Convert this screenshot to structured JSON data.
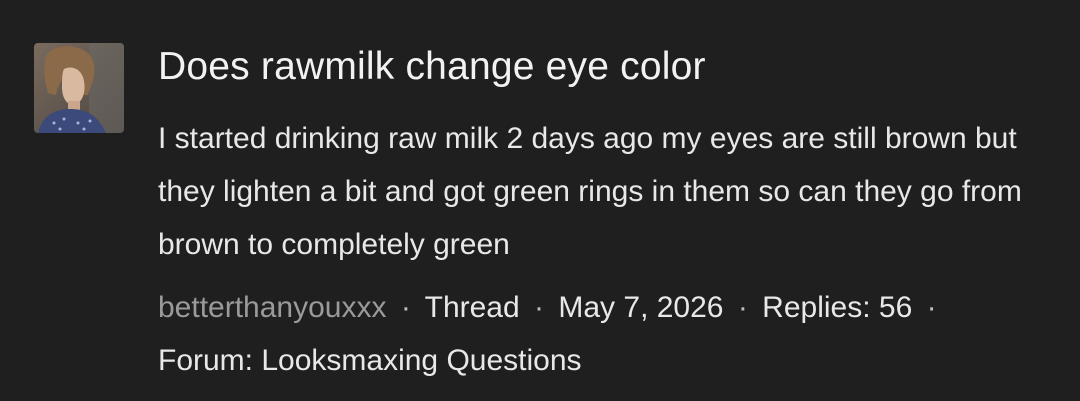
{
  "result": {
    "avatar_icon": "user-avatar-photo",
    "title": "Does rawmilk change eye color",
    "snippet": "I started drinking raw milk 2 days ago my eyes are still brown but they lighten a bit and got green rings in them so can they go from brown to completely green",
    "meta": {
      "author": "betterthanyouxxx",
      "separator": "·",
      "type": "Thread",
      "date": "May 7, 2026",
      "replies": "Replies: 56",
      "forum": "Forum: Looksmaxing Questions"
    }
  },
  "colors": {
    "background": "#1f1f1f",
    "text": "#e8e8e8",
    "author": "#9a9a9a"
  }
}
